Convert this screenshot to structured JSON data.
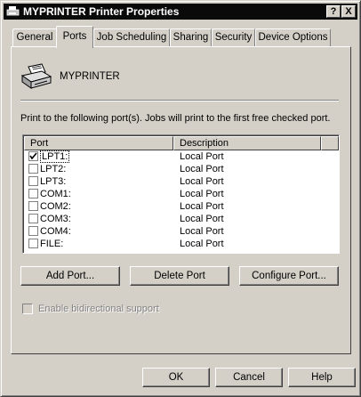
{
  "window": {
    "title": "MYPRINTER Printer Properties",
    "help_label": "?",
    "close_label": "X"
  },
  "tabs": [
    {
      "label": "General"
    },
    {
      "label": "Ports"
    },
    {
      "label": "Job Scheduling"
    },
    {
      "label": "Sharing"
    },
    {
      "label": "Security"
    },
    {
      "label": "Device Options"
    }
  ],
  "active_tab": "Ports",
  "printer": {
    "name": "MYPRINTER",
    "icon": "printer-icon"
  },
  "ports_text": "Print to the following port(s).  Jobs will print to the first free checked port.",
  "table": {
    "headers": {
      "port": "Port",
      "description": "Description"
    },
    "rows": [
      {
        "port": "LPT1:",
        "description": "Local Port",
        "checked": true
      },
      {
        "port": "LPT2:",
        "description": "Local Port",
        "checked": false
      },
      {
        "port": "LPT3:",
        "description": "Local Port",
        "checked": false
      },
      {
        "port": "COM1:",
        "description": "Local Port",
        "checked": false
      },
      {
        "port": "COM2:",
        "description": "Local Port",
        "checked": false
      },
      {
        "port": "COM3:",
        "description": "Local Port",
        "checked": false
      },
      {
        "port": "COM4:",
        "description": "Local Port",
        "checked": false
      },
      {
        "port": "FILE:",
        "description": "Local Port",
        "checked": false
      }
    ]
  },
  "buttons": {
    "add_port": "Add Port...",
    "delete_port": "Delete Port",
    "configure_port": "Configure Port..."
  },
  "bidirectional": {
    "label": "Enable bidirectional support",
    "checked": false,
    "enabled": false
  },
  "footer": {
    "ok": "OK",
    "cancel": "Cancel",
    "help": "Help"
  }
}
